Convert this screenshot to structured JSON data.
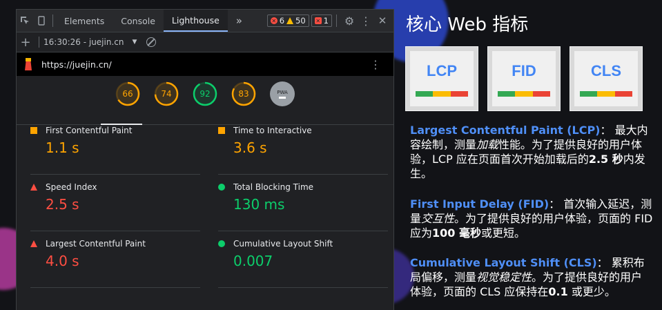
{
  "devtools": {
    "tabs": [
      "Elements",
      "Console",
      "Lighthouse"
    ],
    "active_tab": "Lighthouse",
    "more_tabs": "»",
    "badges": {
      "errors": "6",
      "warnings": "50",
      "issues": "1"
    },
    "report_selector": "16:30:26 - juejin.cn",
    "url": "https://juejin.cn/",
    "gauges": [
      {
        "score": "66",
        "fraction": 0.66,
        "color": "#ffa400"
      },
      {
        "score": "74",
        "fraction": 0.74,
        "color": "#ffa400"
      },
      {
        "score": "92",
        "fraction": 0.92,
        "color": "#0cce6b"
      },
      {
        "score": "83",
        "fraction": 0.83,
        "color": "#ffa400"
      },
      {
        "score": "PWA",
        "fraction": 0,
        "color": "#9aa0a6"
      }
    ],
    "metrics": [
      {
        "label": "First Contentful Paint",
        "value": "1.1 s",
        "status": "average",
        "color": "#ffa400"
      },
      {
        "label": "Time to Interactive",
        "value": "3.6 s",
        "status": "average",
        "color": "#ffa400"
      },
      {
        "label": "Speed Index",
        "value": "2.5 s",
        "status": "fail",
        "color": "#ff4e42"
      },
      {
        "label": "Total Blocking Time",
        "value": "130 ms",
        "status": "pass",
        "color": "#0cce6b"
      },
      {
        "label": "Largest Contentful Paint",
        "value": "4.0 s",
        "status": "fail",
        "color": "#ff4e42"
      },
      {
        "label": "Cumulative Layout Shift",
        "value": "0.007",
        "status": "pass",
        "color": "#0cce6b"
      }
    ]
  },
  "slide": {
    "title": "核心 Web 指标",
    "thumbs": [
      "LCP",
      "FID",
      "CLS"
    ],
    "lcp": {
      "name": "Largest Contentful Paint (LCP)",
      "p1": "： 最大内容绘制，测量",
      "em": "加载",
      "p2": "性能。为了提供良好的用户体验，LCP 应在页面首次开始加载后的",
      "b": "2.5 秒",
      "p3": "内发生。"
    },
    "fid": {
      "name": "First Input Delay (FID)",
      "p1": "： 首次输入延迟，测量",
      "em": "交互性",
      "p2": "。为了提供良好的用户体验，页面的 FID 应为",
      "b": "100 毫秒",
      "p3": "或更短。"
    },
    "cls": {
      "name": "Cumulative Layout Shift (CLS)",
      "p1": "： 累积布局偏移，测量",
      "em": "视觉稳定性",
      "p2": "。为了提供良好的用户体验，页面的 CLS 应保持在",
      "b": "0.1",
      "p3": " 或更少。"
    }
  }
}
